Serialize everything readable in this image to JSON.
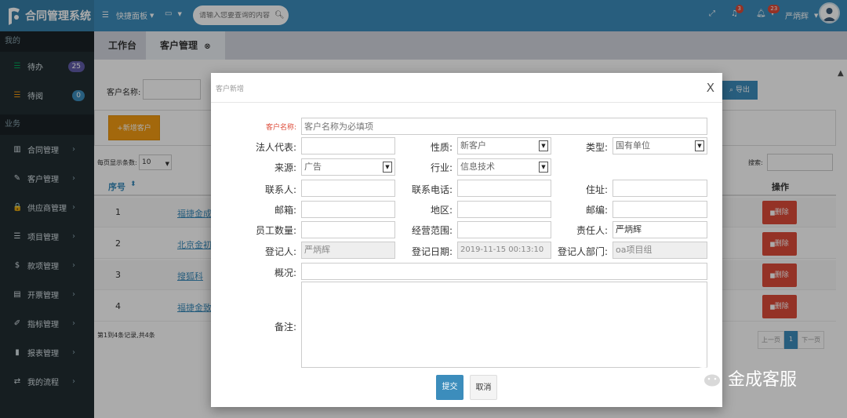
{
  "app": {
    "title": "合同管理系统",
    "user": "严炳辉"
  },
  "topbar": {
    "dashboard": "快捷面板",
    "search_placeholder": "请输入您要查询的内容",
    "badge_a": "3",
    "badge_b": "23"
  },
  "sidebar": {
    "section_mine": "我的",
    "pending": {
      "label": "待办",
      "count": "25"
    },
    "read": {
      "label": "待阅",
      "count": "0"
    },
    "section_business": "业务",
    "items": [
      {
        "label": "合同管理",
        "icon": "book-icon"
      },
      {
        "label": "客户管理",
        "icon": "graduation-icon"
      },
      {
        "label": "供应商管理",
        "icon": "lock-icon"
      },
      {
        "label": "项目管理",
        "icon": "list-icon"
      },
      {
        "label": "款项管理",
        "icon": "dollar-icon"
      },
      {
        "label": "开票管理",
        "icon": "invoice-icon"
      },
      {
        "label": "指标管理",
        "icon": "pencil-icon"
      },
      {
        "label": "报表管理",
        "icon": "bar-chart-icon"
      },
      {
        "label": "我的流程",
        "icon": "exchange-icon"
      }
    ]
  },
  "tabs": [
    {
      "label": "工作台"
    },
    {
      "label": "客户管理"
    }
  ],
  "list": {
    "name_label": "客户名称:",
    "export": "导出",
    "add_button": "+新增客户",
    "page_size_label": "每页显示条数:",
    "page_size": "10",
    "search_label": "搜索:",
    "col_no": "序号",
    "col_op": "操作",
    "rows": [
      {
        "no": "1",
        "name": "福捷金成",
        "delete": "删除"
      },
      {
        "no": "2",
        "name": "北京金初",
        "delete": "删除"
      },
      {
        "no": "3",
        "name": "搜狐科",
        "delete": "删除"
      },
      {
        "no": "4",
        "name": "福捷金致",
        "delete": "删除"
      }
    ],
    "summary": "第1到4条记录,共4条",
    "prev": "上一页",
    "page": "1",
    "next": "下一页"
  },
  "modal": {
    "title": "客户新增",
    "close": "X",
    "customer_name_label": "客户名称:",
    "customer_name_placeholder": "客户名称为必填项",
    "legal_rep_label": "法人代表:",
    "nature_label": "性质:",
    "nature_value": "新客户",
    "type_label": "类型:",
    "type_value": "国有单位",
    "source_label": "来源:",
    "source_value": "广告",
    "industry_label": "行业:",
    "industry_value": "信息技术",
    "contact_label": "联系人:",
    "phone_label": "联系电话:",
    "address_label": "住址:",
    "email_label": "邮箱:",
    "region_label": "地区:",
    "zip_label": "邮编:",
    "staff_label": "员工数量:",
    "scope_label": "经营范围:",
    "owner_label": "责任人:",
    "owner_value": "严炳辉",
    "registrar_label": "登记人:",
    "registrar_value": "严炳辉",
    "reg_date_label": "登记日期:",
    "reg_date_value": "2019-11-15 00:13:10",
    "reg_dept_label": "登记人部门:",
    "reg_dept_value": "oa项目组",
    "overview_label": "概况:",
    "remark_label": "备注:",
    "submit": "提交",
    "cancel": "取消"
  },
  "watermark": "金成客服",
  "colors": {
    "primary": "#3c8dbc",
    "sidebar": "#222d32",
    "danger": "#dd4b39",
    "warning": "#f39c12",
    "success": "#00a65a"
  }
}
